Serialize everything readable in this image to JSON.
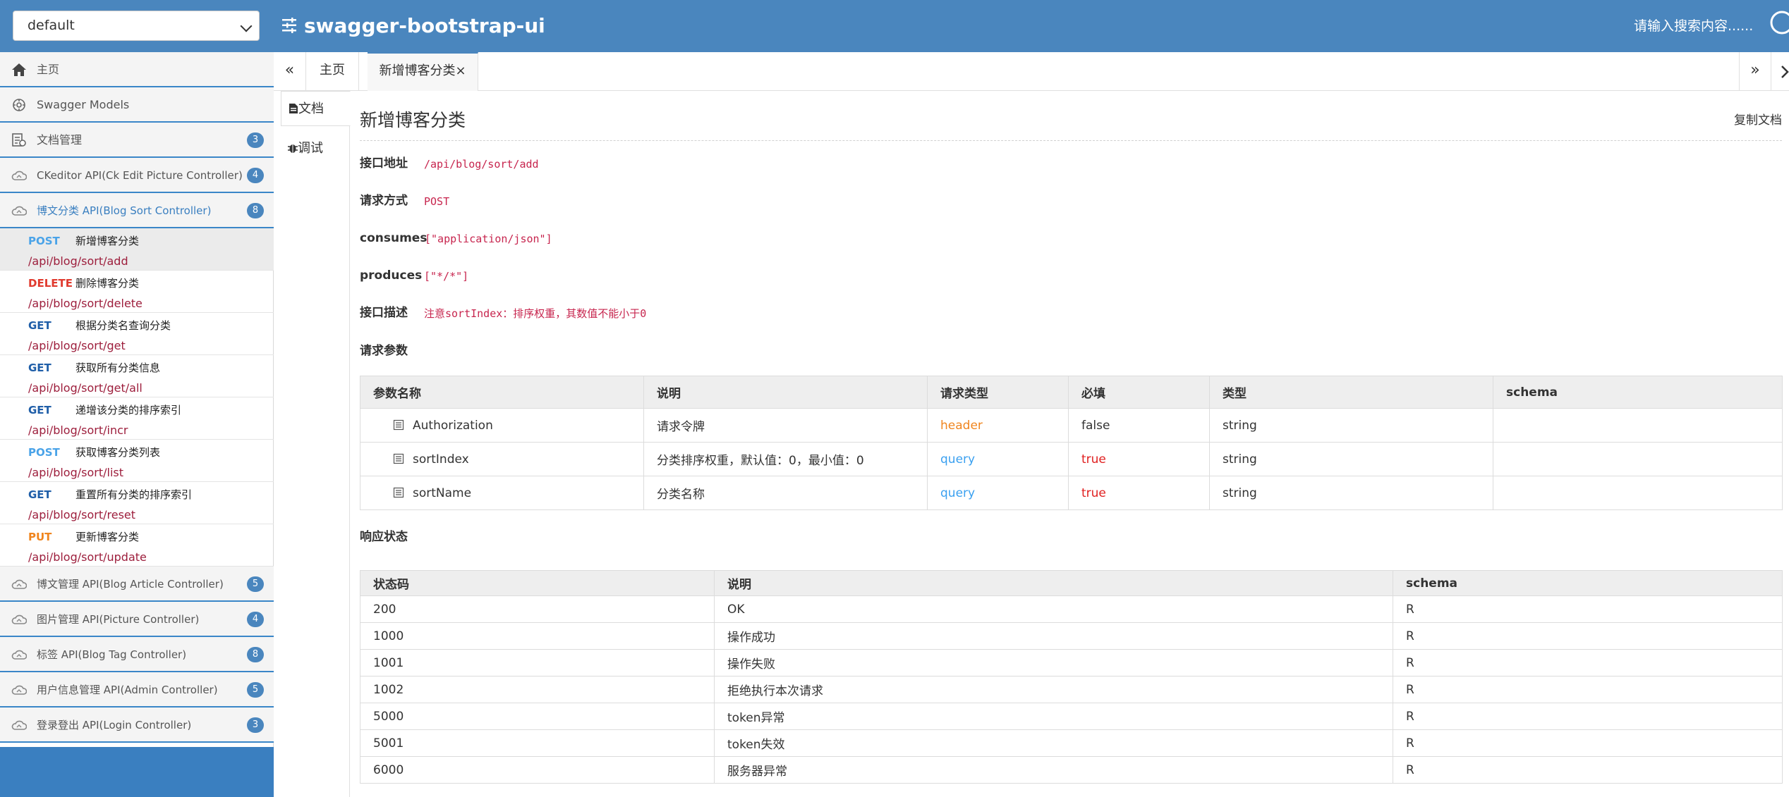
{
  "header": {
    "group_select": "default",
    "app_title": "swagger-bootstrap-ui",
    "search_placeholder": "请输入搜索内容......"
  },
  "sidebar": {
    "top_items": [
      {
        "label": "主页",
        "icon": "home-icon"
      },
      {
        "label": "Swagger Models",
        "icon": "models-icon"
      },
      {
        "label": "文档管理",
        "icon": "doc-manage-icon",
        "badge": "3"
      }
    ],
    "groups_before": [
      {
        "label": "CKeditor API(Ck Edit Picture Controller)",
        "badge": "4"
      },
      {
        "label": "博文分类 API(Blog Sort Controller)",
        "badge": "8"
      }
    ],
    "apis": [
      {
        "method": "POST",
        "summary": "新增博客分类",
        "path": "/api/blog/sort/add",
        "color": "#4aa3e8"
      },
      {
        "method": "DELETE",
        "summary": "删除博客分类",
        "path": "/api/blog/sort/delete",
        "color": "#e03a2e"
      },
      {
        "method": "GET",
        "summary": "根据分类名查询分类",
        "path": "/api/blog/sort/get",
        "color": "#1f5ea8"
      },
      {
        "method": "GET",
        "summary": "获取所有分类信息",
        "path": "/api/blog/sort/get/all",
        "color": "#1f5ea8"
      },
      {
        "method": "GET",
        "summary": "递增该分类的排序索引",
        "path": "/api/blog/sort/incr",
        "color": "#1f5ea8"
      },
      {
        "method": "POST",
        "summary": "获取博客分类列表",
        "path": "/api/blog/sort/list",
        "color": "#4aa3e8"
      },
      {
        "method": "GET",
        "summary": "重置所有分类的排序索引",
        "path": "/api/blog/sort/reset",
        "color": "#1f5ea8"
      },
      {
        "method": "PUT",
        "summary": "更新博客分类",
        "path": "/api/blog/sort/update",
        "color": "#f0851e"
      }
    ],
    "groups_after": [
      {
        "label": "博文管理 API(Blog Article Controller)",
        "badge": "5"
      },
      {
        "label": "图片管理 API(Picture Controller)",
        "badge": "4"
      },
      {
        "label": "标签 API(Blog Tag Controller)",
        "badge": "8"
      },
      {
        "label": "用户信息管理 API(Admin Controller)",
        "badge": "5"
      },
      {
        "label": "登录登出 API(Login Controller)",
        "badge": "3"
      }
    ]
  },
  "tabs": {
    "prev": "«",
    "next": "»",
    "items": [
      {
        "label": "主页"
      },
      {
        "label": "新增博客分类",
        "close": "×"
      }
    ]
  },
  "mininav": {
    "doc": "文档",
    "debug": "调试"
  },
  "doc": {
    "title": "新增博客分类",
    "copy": "复制文档",
    "fields": [
      {
        "label": "接口地址",
        "value": "/api/blog/sort/add"
      },
      {
        "label": "请求方式",
        "value": "POST"
      },
      {
        "label": "consumes",
        "value": "[\"application/json\"]"
      },
      {
        "label": "produces",
        "value": "[\"*/*\"]"
      },
      {
        "label": "接口描述",
        "value": "注意sortIndex：排序权重，其数值不能小于0"
      }
    ],
    "params_title": "请求参数",
    "params_headers": [
      "参数名称",
      "说明",
      "请求类型",
      "必填",
      "类型",
      "schema"
    ],
    "params": [
      {
        "name": "Authorization",
        "desc": "请求令牌",
        "in": "header",
        "required": "false",
        "type": "string",
        "schema": ""
      },
      {
        "name": "sortIndex",
        "desc": "分类排序权重，默认值：0，最小值：0",
        "in": "query",
        "required": "true",
        "type": "string",
        "schema": ""
      },
      {
        "name": "sortName",
        "desc": "分类名称",
        "in": "query",
        "required": "true",
        "type": "string",
        "schema": ""
      }
    ],
    "resp_title": "响应状态",
    "resp_headers": [
      "状态码",
      "说明",
      "schema"
    ],
    "responses": [
      {
        "code": "200",
        "desc": "OK",
        "schema": "R"
      },
      {
        "code": "1000",
        "desc": "操作成功",
        "schema": "R"
      },
      {
        "code": "1001",
        "desc": "操作失败",
        "schema": "R"
      },
      {
        "code": "1002",
        "desc": "拒绝执行本次请求",
        "schema": "R"
      },
      {
        "code": "5000",
        "desc": "token异常",
        "schema": "R"
      },
      {
        "code": "5001",
        "desc": "token失效",
        "schema": "R"
      },
      {
        "code": "6000",
        "desc": "服务器异常",
        "schema": "R"
      }
    ]
  },
  "colors": {
    "brand": "#4a86be",
    "path": "#9d1e3c",
    "header_in": "#f0851e",
    "query_in": "#3aa0f0",
    "required_true": "#e02020"
  }
}
